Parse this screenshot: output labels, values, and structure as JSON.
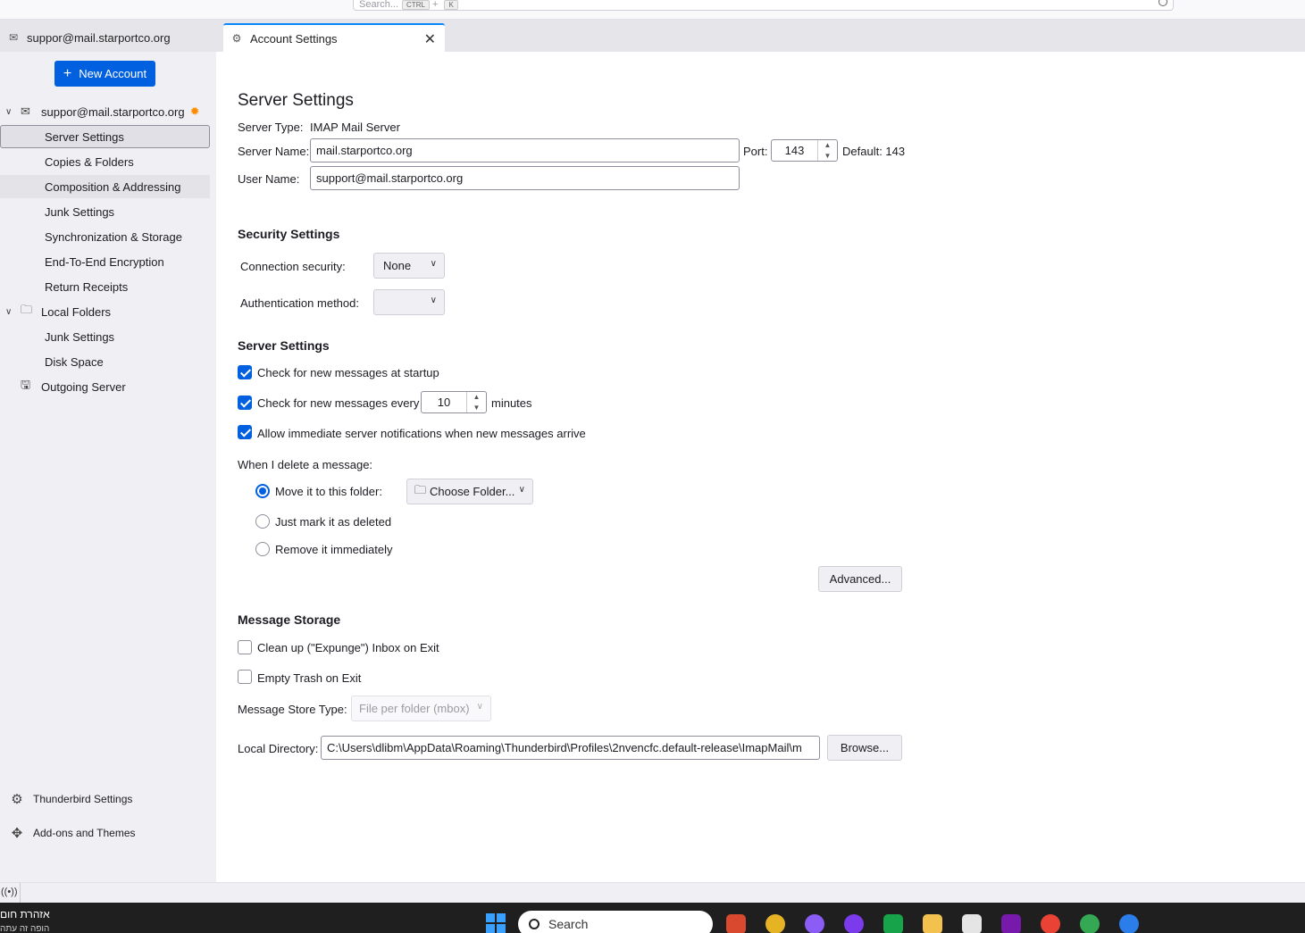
{
  "top_search": {
    "placeholder": "Search...",
    "key1": "CTRL",
    "plus": "+",
    "key2": "K"
  },
  "tabs": [
    {
      "label": "suppor@mail.starportco.org"
    },
    {
      "label": "Account Settings",
      "close": "✕"
    }
  ],
  "sidebar": {
    "new_account": "New Account",
    "account": "suppor@mail.starportco.org",
    "account_items": [
      "Server Settings",
      "Copies & Folders",
      "Composition & Addressing",
      "Junk Settings",
      "Synchronization & Storage",
      "End-To-End Encryption",
      "Return Receipts"
    ],
    "local_folders": "Local Folders",
    "local_items": [
      "Junk Settings",
      "Disk Space"
    ],
    "outgoing": "Outgoing Server",
    "thunderbird_settings": "Thunderbird Settings",
    "addons": "Add-ons and Themes"
  },
  "main": {
    "title": "Server Settings",
    "server_type_label": "Server Type:",
    "server_type_value": "IMAP Mail Server",
    "server_name_label": "Server Name:",
    "server_name_value": "mail.starportco.org",
    "port_label": "Port:",
    "port_value": "143",
    "default_label": "Default: 143",
    "user_name_label": "User Name:",
    "user_name_value": "support@mail.starportco.org",
    "security_heading": "Security Settings",
    "conn_security_label": "Connection security:",
    "conn_security_value": "None",
    "auth_method_label": "Authentication method:",
    "auth_method_value": "",
    "server_settings_heading": "Server Settings",
    "check_startup": "Check for new messages at startup",
    "check_every": "Check for new messages every",
    "check_every_value": "10",
    "minutes": "minutes",
    "allow_notifications": "Allow immediate server notifications when new messages arrive",
    "delete_label": "When I delete a message:",
    "move_to_folder": "Move it to this folder:",
    "choose_folder": "Choose Folder...",
    "just_mark": "Just mark it as deleted",
    "remove_immediately": "Remove it immediately",
    "advanced": "Advanced...",
    "storage_heading": "Message Storage",
    "cleanup_inbox": "Clean up (\"Expunge\") Inbox on Exit",
    "empty_trash": "Empty Trash on Exit",
    "store_type_label": "Message Store Type:",
    "store_type_value": "File per folder (mbox)",
    "local_dir_label": "Local Directory:",
    "local_dir_value": "C:\\Users\\dlibm\\AppData\\Roaming\\Thunderbird\\Profiles\\2nvencfc.default-release\\ImapMail\\m",
    "browse": "Browse..."
  },
  "checkbox_state": {
    "check_startup": true,
    "check_every": true,
    "allow_notifications": true,
    "cleanup_inbox": false,
    "empty_trash": false
  },
  "radio_selected": "move_to_folder",
  "taskbar": {
    "hebrew1": "אזהרת חום",
    "hebrew2": "הופה זה עתה",
    "search": "Search"
  },
  "colors": {
    "accent": "#0060df",
    "tab_highlight": "#0a84ff",
    "star": "#ff8a00"
  }
}
